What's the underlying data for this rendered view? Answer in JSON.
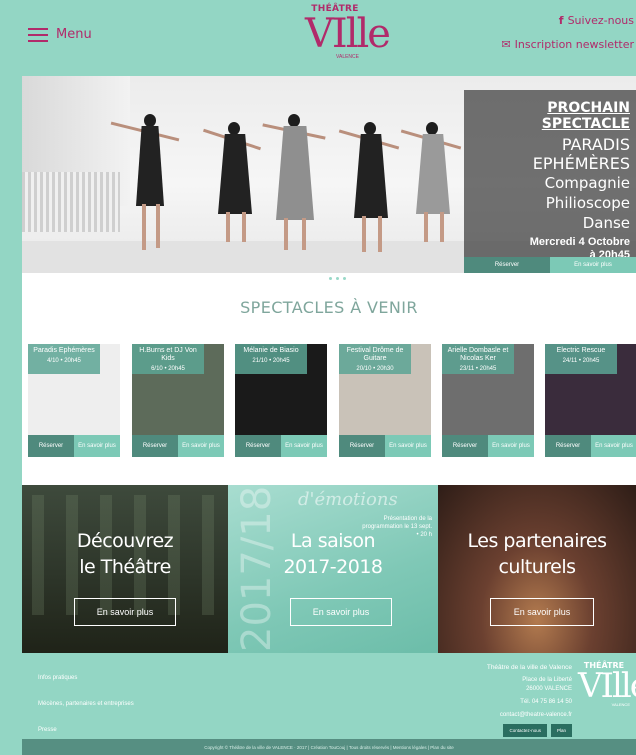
{
  "header": {
    "menu_label": "Menu",
    "logo": {
      "line1": "THÉÂTRE",
      "line2": "VIlle",
      "line3": "VALENCE"
    },
    "follow_label": "Suivez-nous",
    "newsletter_label": "Inscription newsletter"
  },
  "hero": {
    "kicker": "PROCHAIN SPECTACLE",
    "title": "PARADIS EPHÉMÈRES",
    "company_line1": "Compagnie",
    "company_line2": "Philioscope",
    "genre": "Danse",
    "date_line1": "Mercredi 4 Octobre",
    "date_line2": "à 20h45",
    "reserve_label": "Réserver",
    "more_label": "En savoir plus"
  },
  "upcoming": {
    "title": "SPECTACLES À VENIR",
    "cards": [
      {
        "title": "Paradis Ephémères",
        "date": "4/10 • 20h45",
        "reserve": "Réserver",
        "more": "En savoir plus",
        "bg": "#eeeeee"
      },
      {
        "title": "H.Burns et DJ Von Kids",
        "date": "6/10 • 20h45",
        "reserve": "Réserver",
        "more": "En savoir plus",
        "bg": "#5d6b5a"
      },
      {
        "title": "Mélanie de Biasio",
        "date": "21/10 • 20h45",
        "reserve": "Réserver",
        "more": "En savoir plus",
        "bg": "#1a1a1a"
      },
      {
        "title": "Festival Drôme de Guitare",
        "date": "20/10 • 20h30",
        "reserve": "Réserver",
        "more": "En savoir plus",
        "bg": "#c9c2b8"
      },
      {
        "title": "Arielle Dombasle et Nicolas Ker",
        "date": "23/11 • 20h45",
        "reserve": "Réserver",
        "more": "En savoir plus",
        "bg": "#6e6e6e"
      },
      {
        "title": "Electric Rescue",
        "date": "24/11 • 20h45",
        "reserve": "Réserver",
        "more": "En savoir plus",
        "bg": "#3a2c3c"
      }
    ]
  },
  "promo": {
    "panel1": {
      "line1": "Découvrez",
      "line2": "le Théâtre",
      "button": "En savoir plus"
    },
    "panel2": {
      "line1": "La saison",
      "line2": "2017-2018",
      "button": "En savoir plus",
      "bg_year": "2017/18",
      "bg_text": "d'émotions",
      "presentation": "Présentation de la programmation le 13 sept. • 20 h"
    },
    "panel3": {
      "line1": "Les partenaires",
      "line2": "culturels",
      "button": "En savoir plus"
    }
  },
  "footer": {
    "links": [
      "Infos pratiques",
      "Mécènes, partenaires et entreprises",
      "Presse"
    ],
    "address_name": "Théâtre de la ville de Valence",
    "address_line1": "Place de la Liberté",
    "address_line2": "26000 VALENCE",
    "phone": "Tél. 04 75 86 14 50",
    "email": "contact@theatre-valence.fr",
    "mini_btn1": "Contactez-nous",
    "mini_btn2": "Plan",
    "logo": {
      "line1": "THÉÂTRE",
      "line2": "VIlle",
      "line3": "VALENCE"
    },
    "copyright": "Copyright © Théâtre de la ville de VALENCE · 2017 | Création TouCouj | Tous droits réservés | Mentions légales | Plan du site"
  },
  "colors": {
    "accent": "#b12a6a",
    "mint": "#93d6c4",
    "teal_dark": "#4f8a7d",
    "teal_light": "#7cc9b6"
  },
  "icons": {
    "menu": "hamburger-icon",
    "facebook": "facebook-icon",
    "newsletter": "envelope-icon"
  }
}
